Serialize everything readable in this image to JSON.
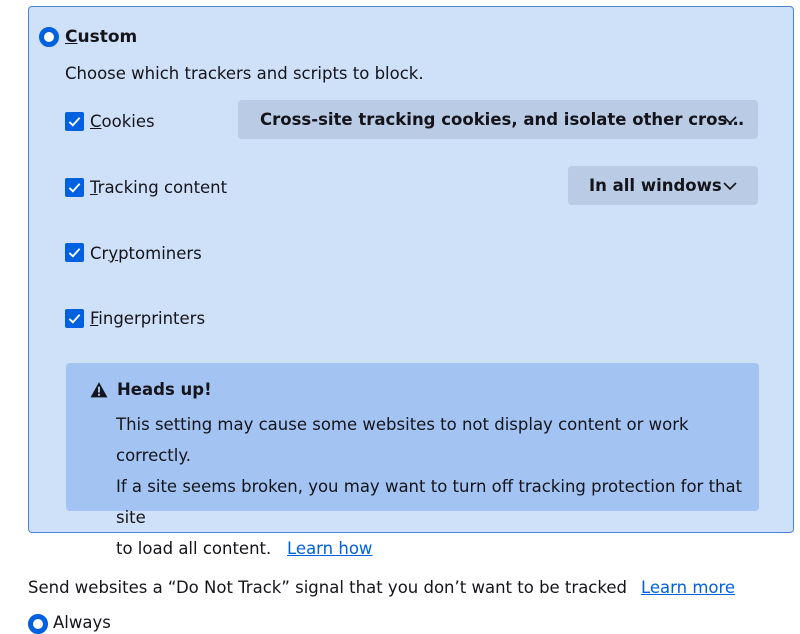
{
  "custom": {
    "label_first": "C",
    "label_rest": "ustom",
    "description": "Choose which trackers and scripts to block."
  },
  "options": {
    "cookies": {
      "accesskey": "C",
      "rest": "ookies",
      "checked": true
    },
    "tracking": {
      "accesskey": "T",
      "rest": "racking content",
      "checked": true
    },
    "crypto": {
      "pre": "Cr",
      "accesskey": "y",
      "rest": "ptominers",
      "checked": true
    },
    "fingerprinters": {
      "accesskey": "F",
      "rest": "ingerprinters",
      "checked": true
    }
  },
  "dropdowns": {
    "cookies_value": "Cross-site tracking cookies, and isolate other cros…",
    "tracking_value": "In all windows"
  },
  "warning": {
    "title": "Heads up!",
    "line1": "This setting may cause some websites to not display content or work correctly.",
    "line2": "If a site seems broken, you may want to turn off tracking protection for that site",
    "line3": "to load all content.",
    "link": "Learn how"
  },
  "dnt": {
    "text": "Send websites a “Do Not Track” signal that you don’t want to be tracked",
    "link": "Learn more",
    "always_label": "Always"
  },
  "colors": {
    "accent": "#0061e0",
    "panel_bg": "#cfe0f9",
    "warning_bg": "#a3c4f3"
  }
}
